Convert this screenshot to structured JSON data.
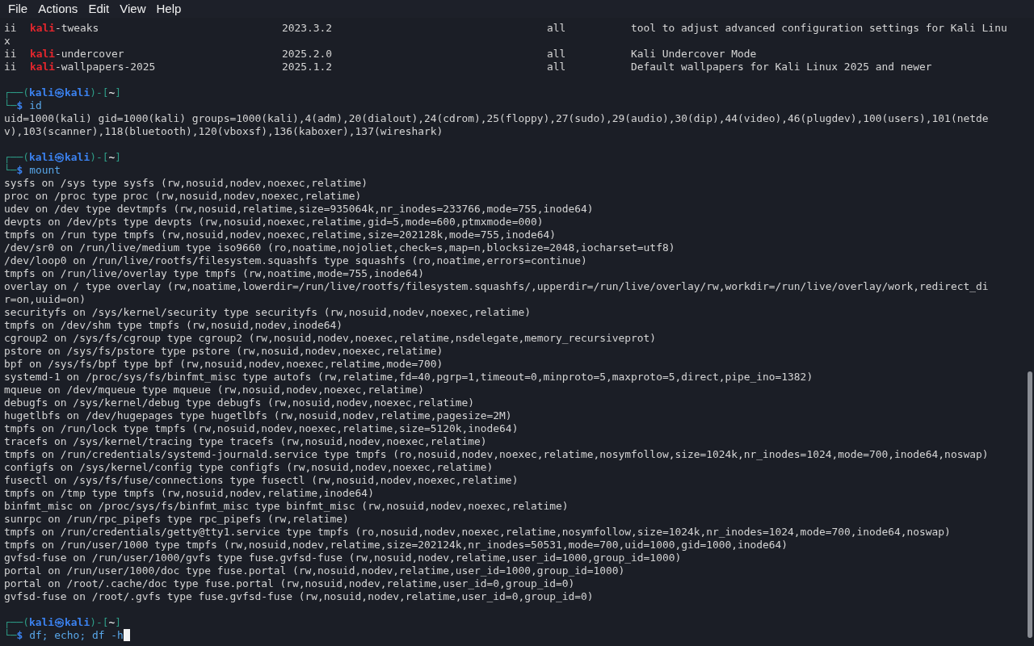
{
  "menu": [
    "File",
    "Actions",
    "Edit",
    "View",
    "Help"
  ],
  "lines": [
    {
      "kind": "dpkg",
      "status": "ii",
      "highlight": "kali",
      "name": "-tweaks",
      "version": "2023.3.2",
      "arch": "all",
      "description": "tool to adjust advanced configuration settings for Kali Linu"
    },
    {
      "kind": "output",
      "text": "x"
    },
    {
      "kind": "dpkg",
      "status": "ii",
      "highlight": "kali",
      "name": "-undercover",
      "version": "2025.2.0",
      "arch": "all",
      "description": "Kali Undercover Mode"
    },
    {
      "kind": "dpkg",
      "status": "ii",
      "highlight": "kali",
      "name": "-wallpapers-2025",
      "version": "2025.1.2",
      "arch": "all",
      "description": "Default wallpapers for Kali Linux 2025 and newer"
    },
    {
      "kind": "blank"
    },
    {
      "kind": "prompt",
      "open": "┌──(",
      "user": "kali",
      "at": "㉿",
      "host": "kali",
      "mid": ")-[",
      "dir": "~",
      "close": "]",
      "corner": "└─",
      "dollar": "$",
      "command": "id",
      "cursor": false
    },
    {
      "kind": "output",
      "text": "uid=1000(kali) gid=1000(kali) groups=1000(kali),4(adm),20(dialout),24(cdrom),25(floppy),27(sudo),29(audio),30(dip),44(video),46(plugdev),100(users),101(netde"
    },
    {
      "kind": "output",
      "text": "v),103(scanner),118(bluetooth),120(vboxsf),136(kaboxer),137(wireshark)"
    },
    {
      "kind": "blank"
    },
    {
      "kind": "prompt",
      "open": "┌──(",
      "user": "kali",
      "at": "㉿",
      "host": "kali",
      "mid": ")-[",
      "dir": "~",
      "close": "]",
      "corner": "└─",
      "dollar": "$",
      "command": "mount",
      "cursor": false
    },
    {
      "kind": "output",
      "text": "sysfs on /sys type sysfs (rw,nosuid,nodev,noexec,relatime)"
    },
    {
      "kind": "output",
      "text": "proc on /proc type proc (rw,nosuid,nodev,noexec,relatime)"
    },
    {
      "kind": "output",
      "text": "udev on /dev type devtmpfs (rw,nosuid,relatime,size=935064k,nr_inodes=233766,mode=755,inode64)"
    },
    {
      "kind": "output",
      "text": "devpts on /dev/pts type devpts (rw,nosuid,noexec,relatime,gid=5,mode=600,ptmxmode=000)"
    },
    {
      "kind": "output",
      "text": "tmpfs on /run type tmpfs (rw,nosuid,nodev,noexec,relatime,size=202128k,mode=755,inode64)"
    },
    {
      "kind": "output",
      "text": "/dev/sr0 on /run/live/medium type iso9660 (ro,noatime,nojoliet,check=s,map=n,blocksize=2048,iocharset=utf8)"
    },
    {
      "kind": "output",
      "text": "/dev/loop0 on /run/live/rootfs/filesystem.squashfs type squashfs (ro,noatime,errors=continue)"
    },
    {
      "kind": "output",
      "text": "tmpfs on /run/live/overlay type tmpfs (rw,noatime,mode=755,inode64)"
    },
    {
      "kind": "output",
      "text": "overlay on / type overlay (rw,noatime,lowerdir=/run/live/rootfs/filesystem.squashfs/,upperdir=/run/live/overlay/rw,workdir=/run/live/overlay/work,redirect_di"
    },
    {
      "kind": "output",
      "text": "r=on,uuid=on)"
    },
    {
      "kind": "output",
      "text": "securityfs on /sys/kernel/security type securityfs (rw,nosuid,nodev,noexec,relatime)"
    },
    {
      "kind": "output",
      "text": "tmpfs on /dev/shm type tmpfs (rw,nosuid,nodev,inode64)"
    },
    {
      "kind": "output",
      "text": "cgroup2 on /sys/fs/cgroup type cgroup2 (rw,nosuid,nodev,noexec,relatime,nsdelegate,memory_recursiveprot)"
    },
    {
      "kind": "output",
      "text": "pstore on /sys/fs/pstore type pstore (rw,nosuid,nodev,noexec,relatime)"
    },
    {
      "kind": "output",
      "text": "bpf on /sys/fs/bpf type bpf (rw,nosuid,nodev,noexec,relatime,mode=700)"
    },
    {
      "kind": "output",
      "text": "systemd-1 on /proc/sys/fs/binfmt_misc type autofs (rw,relatime,fd=40,pgrp=1,timeout=0,minproto=5,maxproto=5,direct,pipe_ino=1382)"
    },
    {
      "kind": "output",
      "text": "mqueue on /dev/mqueue type mqueue (rw,nosuid,nodev,noexec,relatime)"
    },
    {
      "kind": "output",
      "text": "debugfs on /sys/kernel/debug type debugfs (rw,nosuid,nodev,noexec,relatime)"
    },
    {
      "kind": "output",
      "text": "hugetlbfs on /dev/hugepages type hugetlbfs (rw,nosuid,nodev,relatime,pagesize=2M)"
    },
    {
      "kind": "output",
      "text": "tmpfs on /run/lock type tmpfs (rw,nosuid,nodev,noexec,relatime,size=5120k,inode64)"
    },
    {
      "kind": "output",
      "text": "tracefs on /sys/kernel/tracing type tracefs (rw,nosuid,nodev,noexec,relatime)"
    },
    {
      "kind": "output",
      "text": "tmpfs on /run/credentials/systemd-journald.service type tmpfs (ro,nosuid,nodev,noexec,relatime,nosymfollow,size=1024k,nr_inodes=1024,mode=700,inode64,noswap)"
    },
    {
      "kind": "output",
      "text": "configfs on /sys/kernel/config type configfs (rw,nosuid,nodev,noexec,relatime)"
    },
    {
      "kind": "output",
      "text": "fusectl on /sys/fs/fuse/connections type fusectl (rw,nosuid,nodev,noexec,relatime)"
    },
    {
      "kind": "output",
      "text": "tmpfs on /tmp type tmpfs (rw,nosuid,nodev,relatime,inode64)"
    },
    {
      "kind": "output",
      "text": "binfmt_misc on /proc/sys/fs/binfmt_misc type binfmt_misc (rw,nosuid,nodev,noexec,relatime)"
    },
    {
      "kind": "output",
      "text": "sunrpc on /run/rpc_pipefs type rpc_pipefs (rw,relatime)"
    },
    {
      "kind": "output",
      "text": "tmpfs on /run/credentials/getty@tty1.service type tmpfs (ro,nosuid,nodev,noexec,relatime,nosymfollow,size=1024k,nr_inodes=1024,mode=700,inode64,noswap)"
    },
    {
      "kind": "output",
      "text": "tmpfs on /run/user/1000 type tmpfs (rw,nosuid,nodev,relatime,size=202124k,nr_inodes=50531,mode=700,uid=1000,gid=1000,inode64)"
    },
    {
      "kind": "output",
      "text": "gvfsd-fuse on /run/user/1000/gvfs type fuse.gvfsd-fuse (rw,nosuid,nodev,relatime,user_id=1000,group_id=1000)"
    },
    {
      "kind": "output",
      "text": "portal on /run/user/1000/doc type fuse.portal (rw,nosuid,nodev,relatime,user_id=1000,group_id=1000)"
    },
    {
      "kind": "output",
      "text": "portal on /root/.cache/doc type fuse.portal (rw,nosuid,nodev,relatime,user_id=0,group_id=0)"
    },
    {
      "kind": "output",
      "text": "gvfsd-fuse on /root/.gvfs type fuse.gvfsd-fuse (rw,nosuid,nodev,relatime,user_id=0,group_id=0)"
    },
    {
      "kind": "blank"
    },
    {
      "kind": "prompt",
      "open": "┌──(",
      "user": "kali",
      "at": "㉿",
      "host": "kali",
      "mid": ")-[",
      "dir": "~",
      "close": "]",
      "corner": "└─",
      "dollar": "$",
      "command": "df; echo; df -h",
      "cursor": true
    }
  ]
}
